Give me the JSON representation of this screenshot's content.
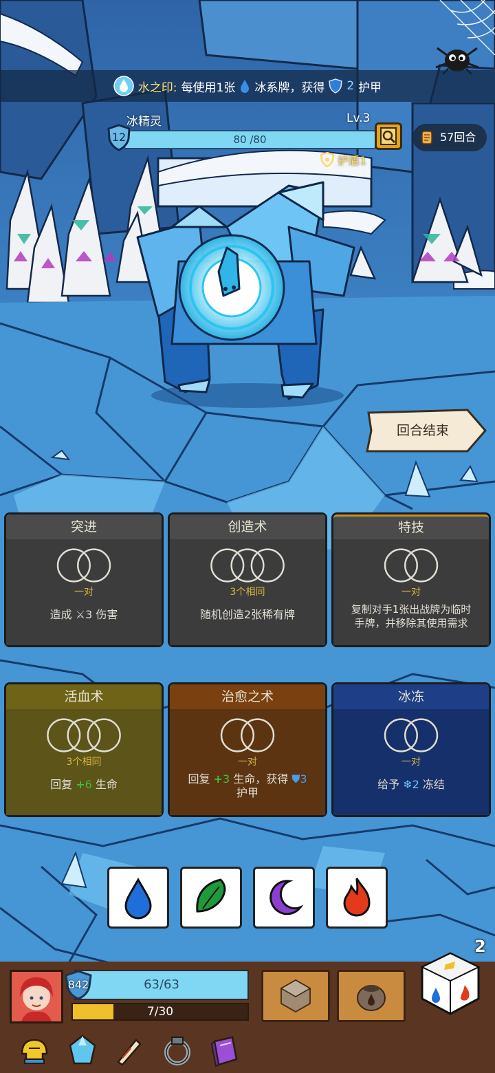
{
  "banner": {
    "seal_name": "水之印:",
    "text1": "每使用1张",
    "text2": "冰系牌，获得",
    "armor_value": "2",
    "text3": "护甲"
  },
  "enemy": {
    "name": "冰精灵",
    "level": "Lv.3",
    "shield_level": "12",
    "hp_text": "80 /80",
    "status": "护盾1"
  },
  "rounds": "57回合",
  "end_turn_label": "回合结束",
  "cards": [
    {
      "title": "突进",
      "requirement": "一对",
      "circles": 2,
      "desc_pre": "造成",
      "desc_value": "3",
      "desc_post": "伤害",
      "theme": "grey"
    },
    {
      "title": "创造术",
      "requirement": "3个相同",
      "circles": 3,
      "desc": "随机创造2张稀有牌",
      "theme": "grey"
    },
    {
      "title": "特技",
      "requirement": "一对",
      "circles": 2,
      "desc_line1": "复制对手1张出战牌为临时",
      "desc_line2": "手牌，并移除其使用需求",
      "theme": "grey"
    },
    {
      "title": "活血术",
      "requirement": "3个相同",
      "circles": 3,
      "desc_pre": "回复",
      "desc_value": "6",
      "desc_post": "生命",
      "theme": "olive"
    },
    {
      "title": "治愈之术",
      "requirement": "一对",
      "circles": 2,
      "desc_pre": "回复",
      "desc_value": "3",
      "desc_mid": "生命，获得",
      "desc_value2": "3",
      "desc_post": "护甲",
      "theme": "brown"
    },
    {
      "title": "冰冻",
      "requirement": "一对",
      "circles": 2,
      "desc_pre": "给予",
      "desc_value": "2",
      "desc_post": "冻结",
      "theme": "navy"
    }
  ],
  "elements": [
    "water-drop-icon",
    "leaf-icon",
    "moon-icon",
    "fire-icon"
  ],
  "player": {
    "shield": "842",
    "hp_text": "63/63",
    "xp_text": "7/30",
    "xp_fraction": 0.2333
  },
  "dice_count": "2",
  "colors": {
    "hp": "#7fd7f4",
    "xp": "#f0c02a",
    "water": "#1e6fd9",
    "leaf": "#1e9a3a",
    "moon": "#8a3fd0",
    "fire": "#e33a1c"
  }
}
